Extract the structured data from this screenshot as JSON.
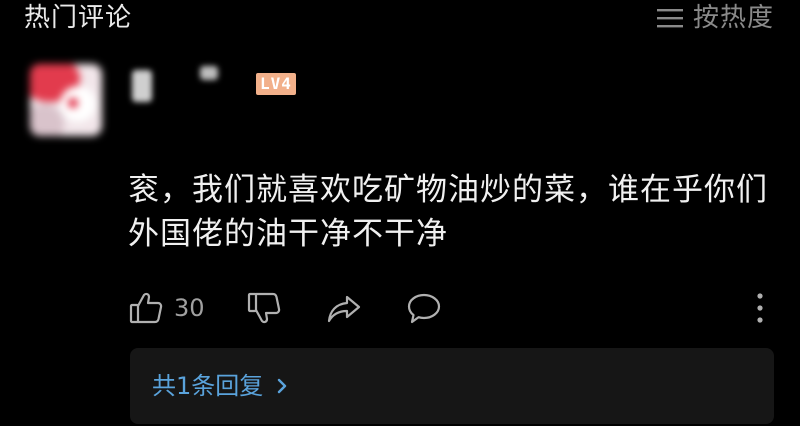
{
  "header": {
    "title": "热门评论",
    "sort_label": "按热度",
    "sort_icon": "menu-lines-icon"
  },
  "comment": {
    "level_badge": "LV4",
    "text": "衮，我们就喜欢吃矿物油炒的菜，谁在乎你们外国佬的油干净不干净",
    "like_count": "30",
    "icons": [
      "thumbs-up-icon",
      "thumbs-down-icon",
      "share-icon",
      "comment-bubble-icon",
      "more-vertical-icon"
    ]
  },
  "replies": {
    "label": "共1条回复"
  },
  "colors": {
    "background": "#000000",
    "text_primary": "#f0f0f0",
    "text_secondary": "#8a8a8a",
    "link": "#5aa3dc",
    "reply_box": "#161616",
    "badge": "#f2b08a"
  }
}
